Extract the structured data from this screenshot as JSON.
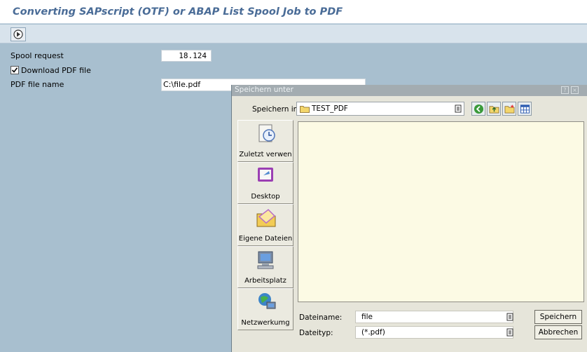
{
  "page": {
    "title": "Converting SAPscript (OTF) or ABAP List Spool Job to PDF"
  },
  "form": {
    "spool_request_label": "Spool request",
    "spool_request_value": "18.124",
    "download_pdf_label": "Download PDF file",
    "download_pdf_checked": true,
    "pdf_file_name_label": "PDF file name",
    "pdf_file_name_value": "C:\\file.pdf"
  },
  "dialog": {
    "title": "Speichern unter",
    "save_in_label": "Speichern in:",
    "save_in_value": "TEST_PDF",
    "places": [
      {
        "label": "Zuletzt verwen",
        "icon": "recent-documents-icon"
      },
      {
        "label": "Desktop",
        "icon": "desktop-icon"
      },
      {
        "label": "Eigene Dateien",
        "icon": "my-documents-icon"
      },
      {
        "label": "Arbeitsplatz",
        "icon": "my-computer-icon"
      },
      {
        "label": "Netzwerkumg",
        "icon": "network-icon"
      }
    ],
    "file_name_label": "Dateiname:",
    "file_name_value": "file",
    "file_type_label": "Dateityp:",
    "file_type_value": "(*.pdf)",
    "save_button": "Speichern",
    "cancel_button": "Abbrechen"
  },
  "colors": {
    "title_text": "#4a6c97",
    "background": "#a8bfcf",
    "dialog_background": "#e6e5da",
    "file_list_background": "#fcfae4"
  }
}
